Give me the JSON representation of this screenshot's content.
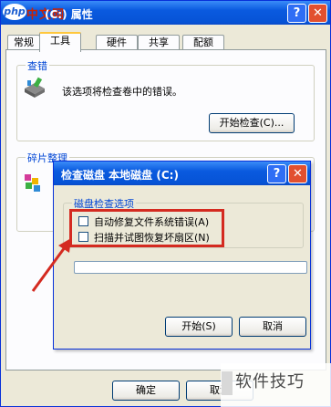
{
  "props_window": {
    "title": "(C:) 属性",
    "logo_text": "php",
    "site_logo_text": "中文网",
    "help_glyph": "?",
    "close_glyph": "✕",
    "tabs": [
      {
        "label": "常规"
      },
      {
        "label": "工具",
        "active": true
      },
      {
        "label": "硬件"
      },
      {
        "label": "共享"
      },
      {
        "label": "配额"
      }
    ],
    "error_check": {
      "group_title": "查错",
      "description": "该选项将检查卷中的错误。",
      "button_label": "开始检查(C)..."
    },
    "defrag": {
      "group_title": "碎片整理"
    },
    "footer": {
      "ok_label": "确定",
      "cancel_label": "取消"
    }
  },
  "check_dialog": {
    "title": "检查磁盘 本地磁盘 (C:)",
    "help_glyph": "?",
    "close_glyph": "✕",
    "options_group_title": "磁盘检查选项",
    "options": [
      {
        "label": "自动修复文件系统错误(A)",
        "checked": false
      },
      {
        "label": "扫描并试图恢复坏扇区(N)",
        "checked": false
      }
    ],
    "progress": 0,
    "start_label": "开始(S)",
    "cancel_label": "取消"
  },
  "watermark": {
    "text": "软件技巧"
  },
  "colors": {
    "titlebar_blue": "#0a5adf",
    "close_red": "#e2502f",
    "group_title_blue": "#0046d5",
    "highlight_red": "#d42a20",
    "dialog_bg": "#ece9d8"
  }
}
